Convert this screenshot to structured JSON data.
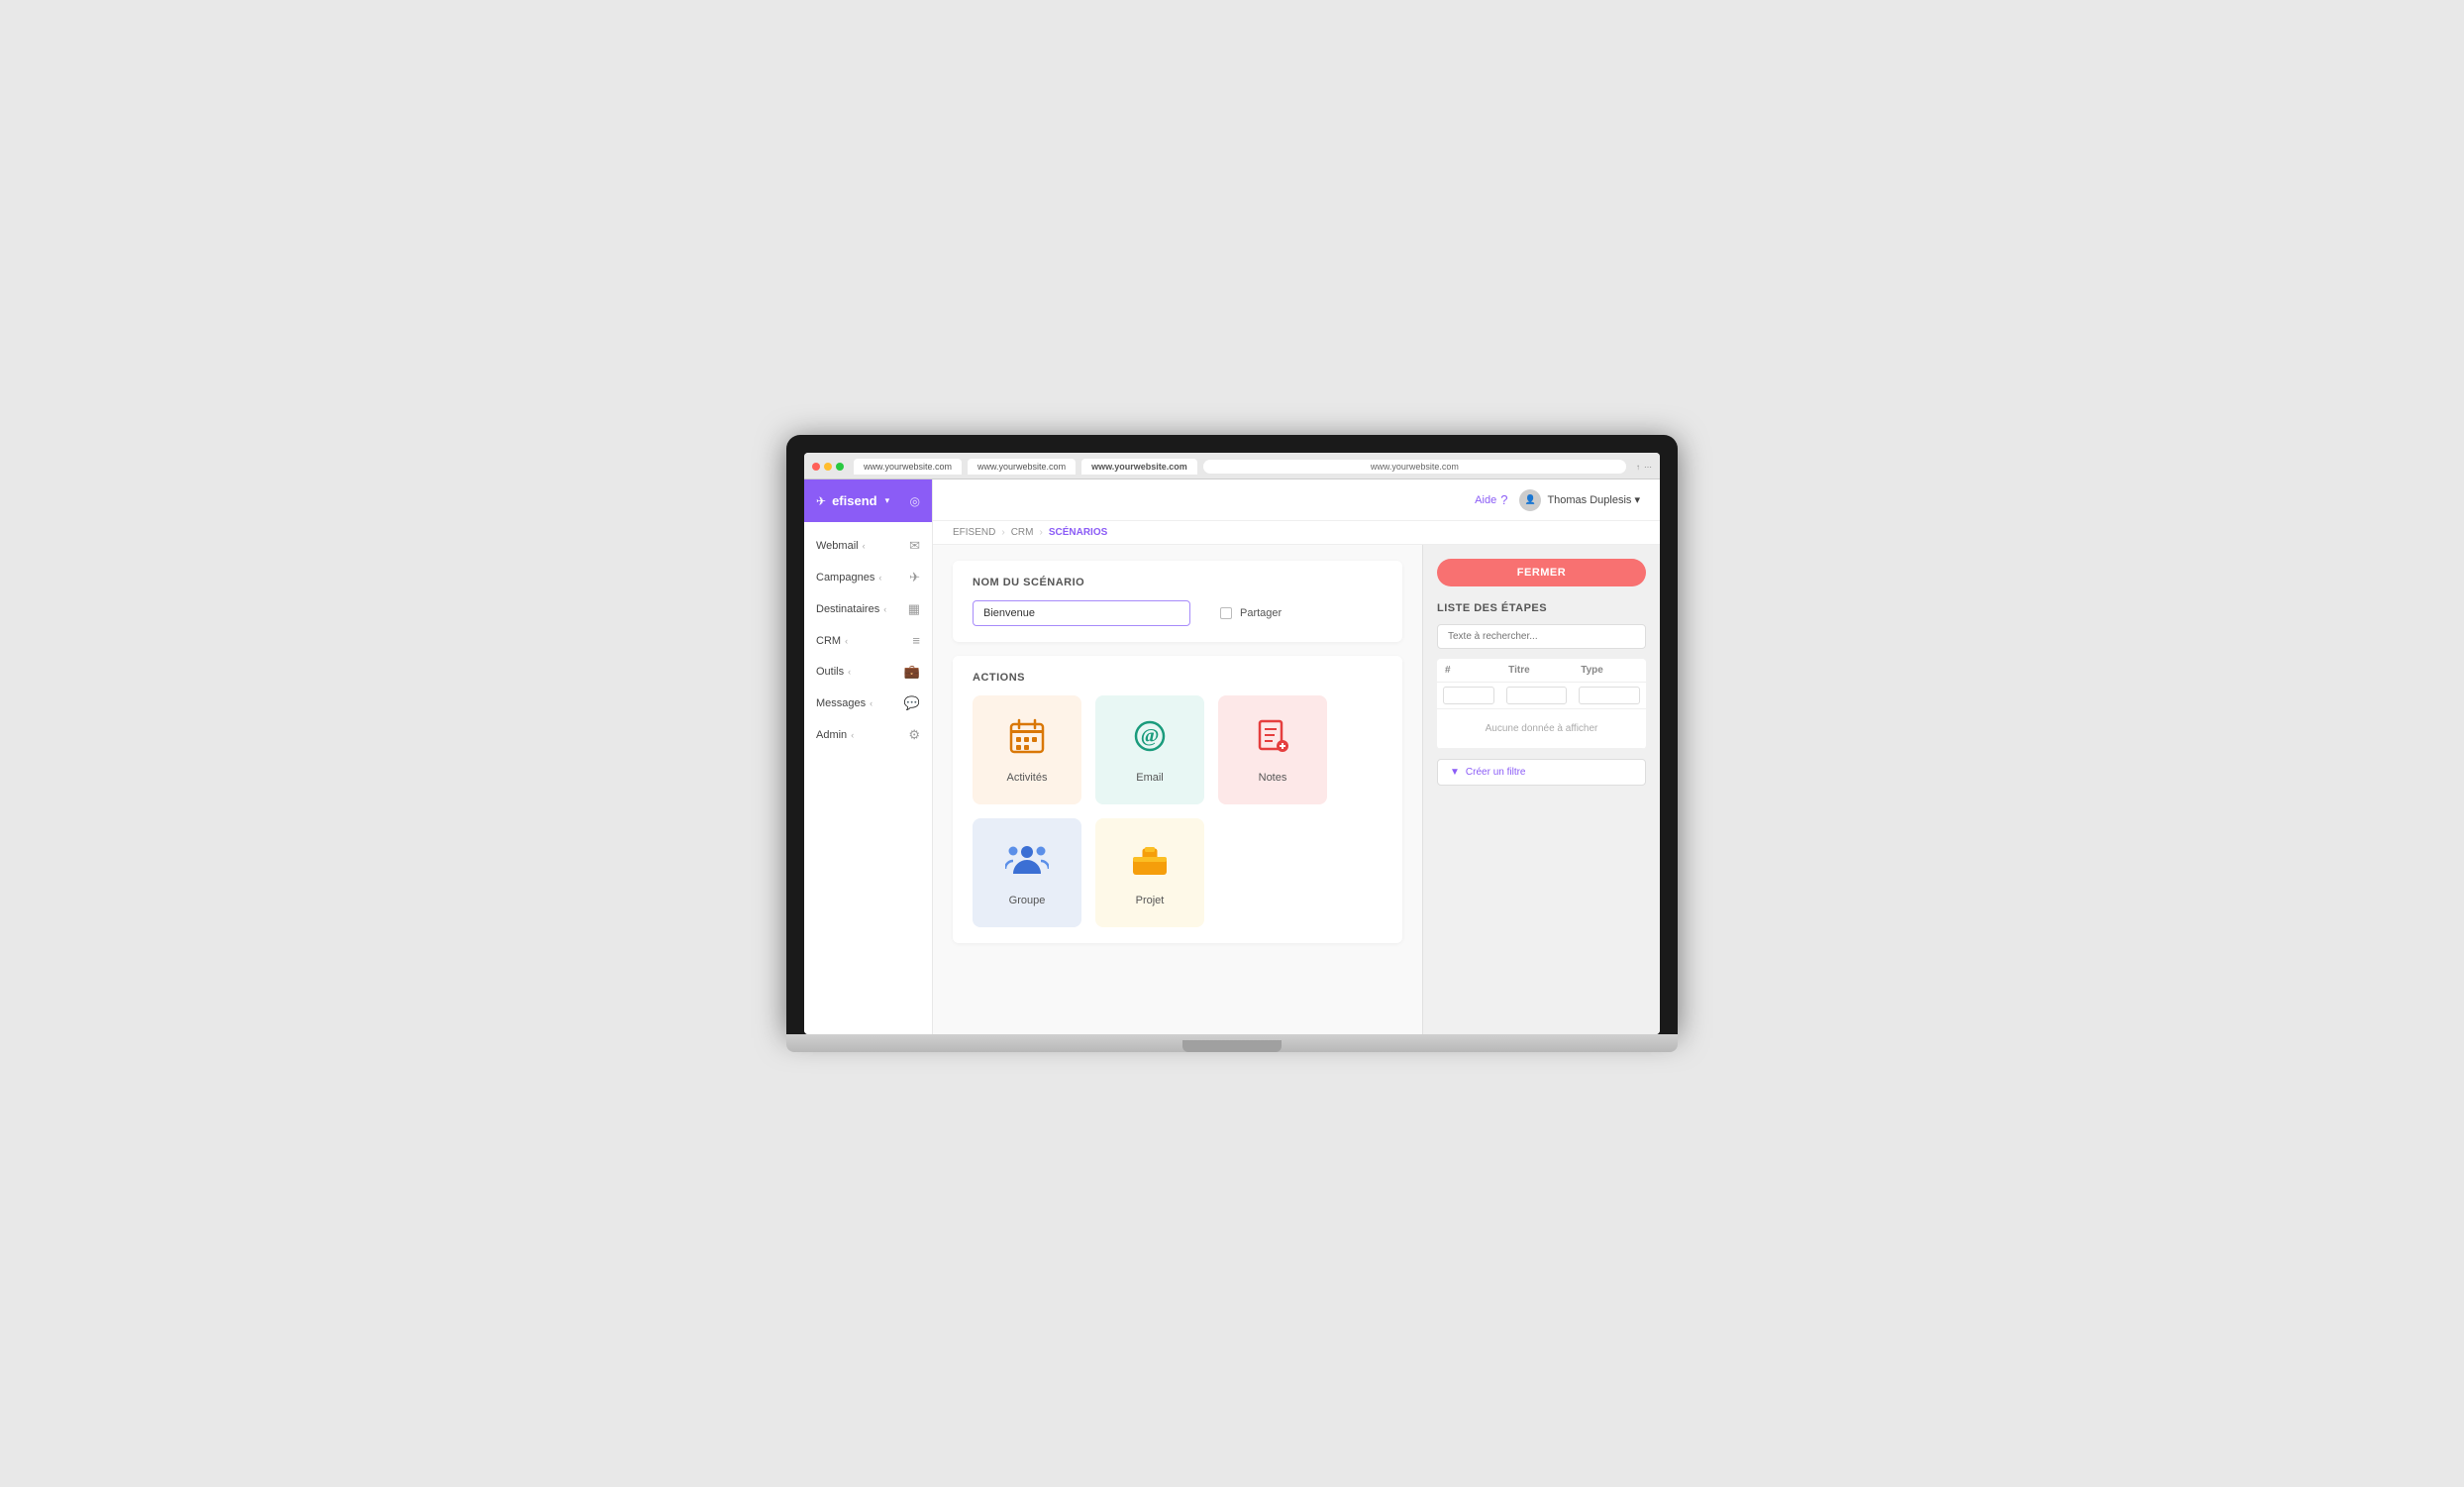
{
  "browser": {
    "tabs": [
      "www.yourwebsite.com",
      "www.yourwebsite.com",
      "www.yourwebsite.com",
      "www.yourwebsite.com"
    ],
    "active_tab": "www.yourwebsite.com"
  },
  "sidebar": {
    "logo": "efisend",
    "items": [
      {
        "label": "Webmail",
        "icon": "✉"
      },
      {
        "label": "Campagnes",
        "icon": "✈"
      },
      {
        "label": "Destinataires",
        "icon": "▦"
      },
      {
        "label": "CRM",
        "icon": "≡"
      },
      {
        "label": "Outils",
        "icon": "💼"
      },
      {
        "label": "Messages",
        "icon": "💬"
      },
      {
        "label": "Admin",
        "icon": "⚙"
      }
    ]
  },
  "topbar": {
    "help_label": "Aide",
    "user_name": "Thomas Duplesis"
  },
  "breadcrumb": {
    "items": [
      "EFISEND",
      "CRM",
      "SCÉNARIOS"
    ]
  },
  "scenario": {
    "section_title": "NOM DU SCÉNARIO",
    "name_value": "Bienvenue",
    "partager_label": "Partager"
  },
  "actions": {
    "section_title": "ACTIONS",
    "items": [
      {
        "label": "Activités",
        "type": "activites",
        "icon": "📅"
      },
      {
        "label": "Email",
        "type": "email",
        "icon": "✉"
      },
      {
        "label": "Notes",
        "type": "notes",
        "icon": "📝"
      },
      {
        "label": "Groupe",
        "type": "groupe",
        "icon": "👥"
      },
      {
        "label": "Projet",
        "type": "projet",
        "icon": "💼"
      }
    ]
  },
  "right_panel": {
    "fermer_label": "FERMER",
    "section_title": "LISTE DES ÉTAPES",
    "search_placeholder": "Texte à rechercher...",
    "table": {
      "columns": [
        "#",
        "Titre",
        "Type"
      ],
      "no_data": "Aucune donnée à afficher"
    },
    "create_filter_label": "Créer un filtre"
  }
}
